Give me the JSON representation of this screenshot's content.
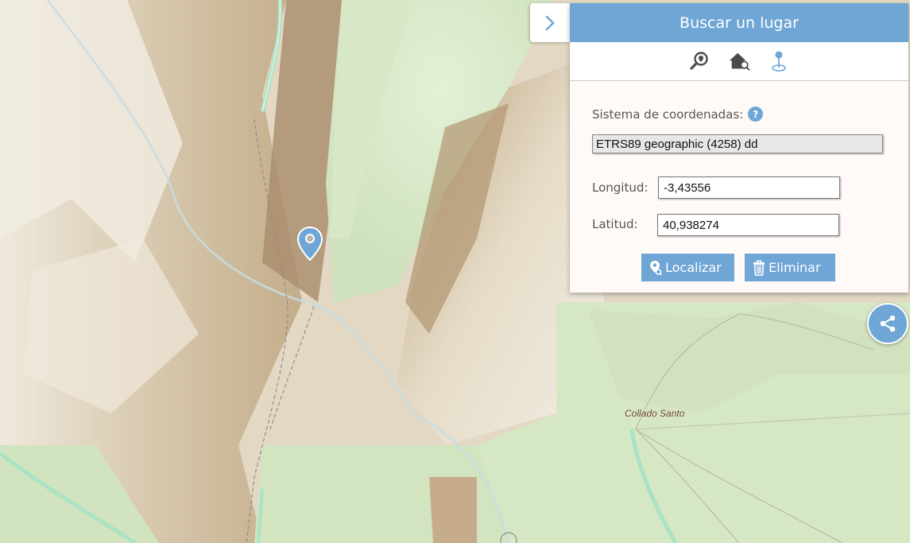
{
  "map": {
    "place_label": "Collado Santo"
  },
  "panel": {
    "title": "Buscar un lugar",
    "tabs": [
      {
        "icon": "magnifier-pin-icon",
        "active": false
      },
      {
        "icon": "house-search-icon",
        "active": false
      },
      {
        "icon": "coordinate-pin-icon",
        "active": true
      }
    ],
    "crs_label": "Sistema de coordenadas:",
    "crs_value": "ETRS89 geographic (4258) dd",
    "longitude_label": "Longitud:",
    "longitude_value": "-3,43556",
    "latitude_label": "Latitud:",
    "latitude_value": "40,938274",
    "locate_label": "Localizar",
    "delete_label": "Eliminar"
  },
  "colors": {
    "accent": "#6fa6d6"
  }
}
